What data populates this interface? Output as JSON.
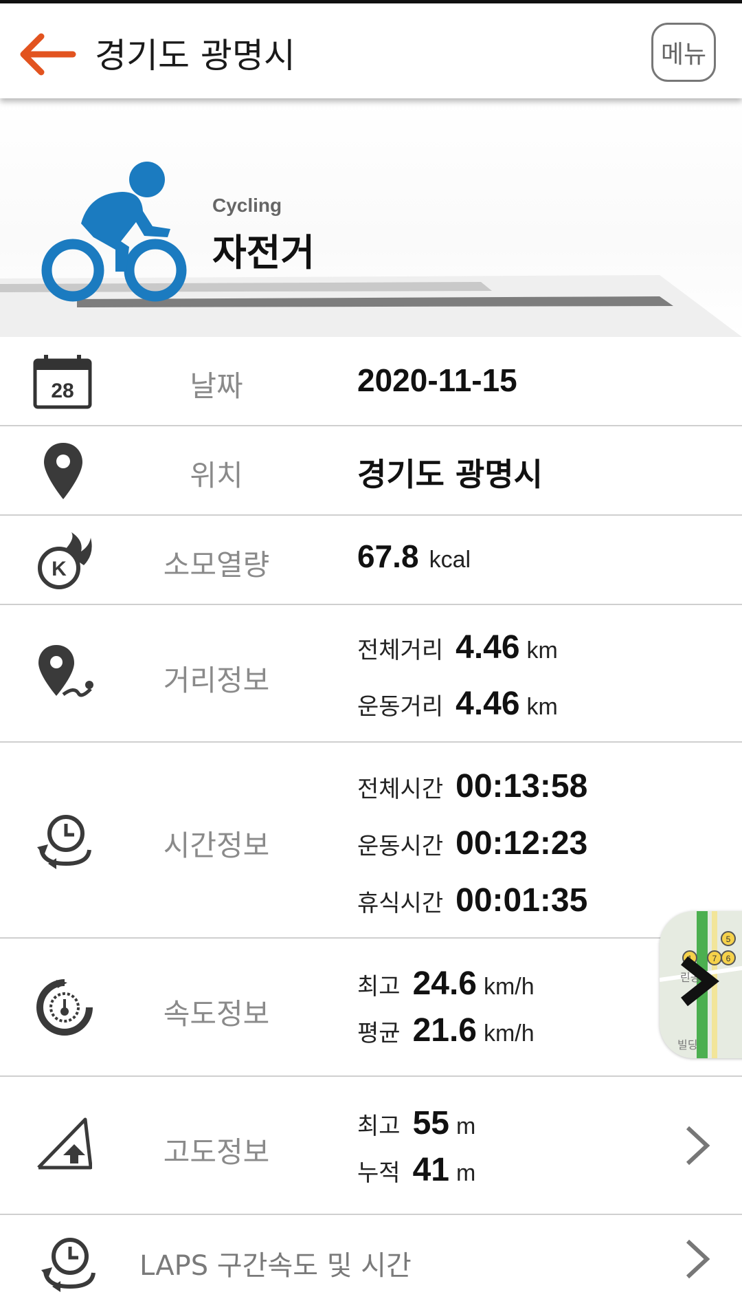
{
  "header": {
    "title": "경기도 광명시",
    "menu_label": "메뉴",
    "back_icon": "arrow-left-icon",
    "accent_color": "#e2531f"
  },
  "activity": {
    "sport_en": "Cycling",
    "sport_ko": "자전거",
    "icon": "cyclist-icon",
    "icon_color": "#1b7bc0"
  },
  "rows": {
    "date": {
      "label": "날짜",
      "value": "2020-11-15",
      "icon": "calendar-icon",
      "icon_text": "28"
    },
    "location": {
      "label": "위치",
      "value": "경기도 광명시",
      "icon": "location-pin-icon"
    },
    "calories": {
      "label": "소모열량",
      "value": "67.8",
      "unit": "kcal",
      "icon": "calorie-flame-icon",
      "icon_text": "K"
    },
    "distance": {
      "label": "거리정보",
      "icon": "distance-pin-icon",
      "items": [
        {
          "label": "전체거리",
          "value": "4.46",
          "unit": "km"
        },
        {
          "label": "운동거리",
          "value": "4.46",
          "unit": "km"
        }
      ]
    },
    "time": {
      "label": "시간정보",
      "icon": "clock-cycle-icon",
      "items": [
        {
          "label": "전체시간",
          "value": "00:13:58"
        },
        {
          "label": "운동시간",
          "value": "00:12:23"
        },
        {
          "label": "휴식시간",
          "value": "00:01:35"
        }
      ]
    },
    "speed": {
      "label": "속도정보",
      "icon": "speedometer-icon",
      "items": [
        {
          "label": "최고",
          "value": "24.6",
          "unit": "km/h"
        },
        {
          "label": "평균",
          "value": "21.6",
          "unit": "km/h"
        }
      ]
    },
    "altitude": {
      "label": "고도정보",
      "icon": "altitude-slope-icon",
      "items": [
        {
          "label": "최고",
          "value": "55",
          "unit": "m"
        },
        {
          "label": "누적",
          "value": "41",
          "unit": "m"
        }
      ]
    },
    "laps": {
      "label": "LAPS 구간속도 및 시간",
      "icon": "laps-clock-icon"
    }
  },
  "map_thumb": {
    "icon": "chevron-right-icon",
    "labels": [
      "린공",
      "빌딩"
    ],
    "markers": [
      "1",
      "5",
      "6",
      "7"
    ]
  }
}
